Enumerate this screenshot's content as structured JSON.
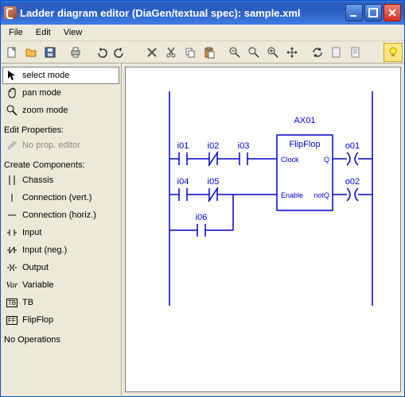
{
  "window": {
    "title": "Ladder diagram editor (DiaGen/textual spec): sample.xml"
  },
  "menu": {
    "file": "File",
    "edit": "Edit",
    "view": "View"
  },
  "sidebar": {
    "modes": {
      "select": "select mode",
      "pan": "pan mode",
      "zoom": "zoom mode"
    },
    "edit_props_header": "Edit Properties:",
    "no_prop": "No prop. editor",
    "create_header": "Create Components:",
    "components": {
      "chassis": "Chassis",
      "conn_vert": "Connection (vert.)",
      "conn_horiz": "Connection (horiz.)",
      "input": "Input",
      "input_neg": "Input (neg.)",
      "output": "Output",
      "variable": "Variable",
      "tb": "TB",
      "flipflop": "FlipFlop"
    },
    "no_ops": "No Operations"
  },
  "diagram": {
    "block_name": "AX01",
    "block_type": "FlipFlop",
    "block_port_clock": "Clock",
    "block_port_enable": "Enable",
    "block_port_q": "Q",
    "block_port_notq": "notQ",
    "i01": "i01",
    "i02": "i02",
    "i03": "i03",
    "i04": "i04",
    "i05": "i05",
    "i06": "i06",
    "o01": "o01",
    "o02": "o02"
  },
  "icons": {
    "var": "Var",
    "tb_box": "TB",
    "ff_box": "FF"
  }
}
